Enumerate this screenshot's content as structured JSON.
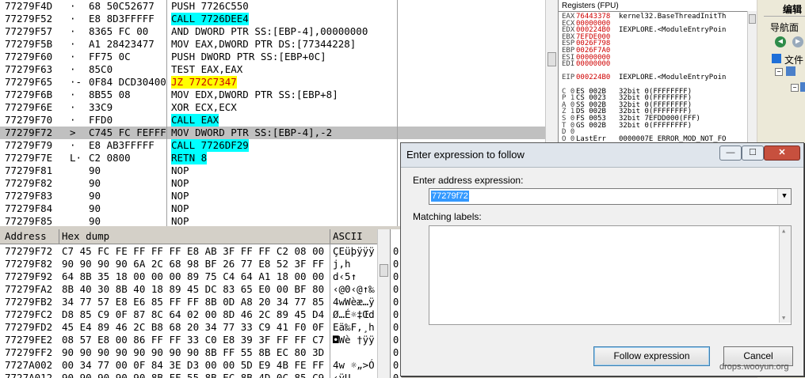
{
  "disasm": {
    "rows": [
      {
        "addr": "77279F4D",
        "mark": "·",
        "hex": "68 50C52677",
        "ins": "PUSH 7726C550",
        "hl": ""
      },
      {
        "addr": "77279F52",
        "mark": "·",
        "hex": "E8 8D3FFFFF",
        "ins": "CALL 7726DEE4",
        "hl": "cyan"
      },
      {
        "addr": "77279F57",
        "mark": "·",
        "hex": "8365 FC 00",
        "ins": "AND DWORD PTR SS:[EBP-4],00000000",
        "hl": ""
      },
      {
        "addr": "77279F5B",
        "mark": "·",
        "hex": "A1 28423477",
        "ins": "MOV EAX,DWORD PTR DS:[77344228]",
        "hl": ""
      },
      {
        "addr": "77279F60",
        "mark": "·",
        "hex": "FF75 0C",
        "ins": "PUSH DWORD PTR SS:[EBP+0C]",
        "hl": ""
      },
      {
        "addr": "77279F63",
        "mark": "·",
        "hex": "85C0",
        "ins": "TEST EAX,EAX",
        "hl": ""
      },
      {
        "addr": "77279F65",
        "mark": "·-",
        "hex": "0F84 DCD30400",
        "ins": "JZ 772C7347",
        "hl": "yellow"
      },
      {
        "addr": "77279F6B",
        "mark": "·",
        "hex": "8B55 08",
        "ins": "MOV EDX,DWORD PTR SS:[EBP+8]",
        "hl": ""
      },
      {
        "addr": "77279F6E",
        "mark": "·",
        "hex": "33C9",
        "ins": "XOR ECX,ECX",
        "hl": ""
      },
      {
        "addr": "77279F70",
        "mark": "·",
        "hex": "FFD0",
        "ins": "CALL EAX",
        "hl": "cyan"
      },
      {
        "addr": "77279F72",
        "mark": ">",
        "hex": "C745 FC FEFFFFFF",
        "ins": "MOV DWORD PTR SS:[EBP-4],-2",
        "hl": "",
        "sel": true
      },
      {
        "addr": "77279F79",
        "mark": "·",
        "hex": "E8 AB3FFFFF",
        "ins": "CALL 7726DF29",
        "hl": "cyan"
      },
      {
        "addr": "77279F7E",
        "mark": "L·",
        "hex": "C2 0800",
        "ins": "RETN 8",
        "hl": "cyan"
      },
      {
        "addr": "77279F81",
        "mark": "",
        "hex": "90",
        "ins": "NOP",
        "hl": ""
      },
      {
        "addr": "77279F82",
        "mark": "",
        "hex": "90",
        "ins": "NOP",
        "hl": ""
      },
      {
        "addr": "77279F83",
        "mark": "",
        "hex": "90",
        "ins": "NOP",
        "hl": ""
      },
      {
        "addr": "77279F84",
        "mark": "",
        "hex": "90",
        "ins": "NOP",
        "hl": ""
      },
      {
        "addr": "77279F85",
        "mark": "",
        "hex": "90",
        "ins": "NOP",
        "hl": ""
      }
    ]
  },
  "registers": {
    "title": "Registers (FPU)",
    "rows": [
      {
        "n": "EAX",
        "v": "76443378",
        "c": "kernel32.BaseThreadInitTh"
      },
      {
        "n": "ECX",
        "v": "00000000",
        "c": ""
      },
      {
        "n": "EDX",
        "v": "000224B0",
        "c": "IEXPLORE.<ModuleEntryPoin"
      },
      {
        "n": "EBX",
        "v": "7EFDE000",
        "c": ""
      },
      {
        "n": "ESP",
        "v": "0026F798",
        "c": ""
      },
      {
        "n": "EBP",
        "v": "0026F7A0",
        "c": ""
      },
      {
        "n": "ESI",
        "v": "00000000",
        "c": ""
      },
      {
        "n": "EDI",
        "v": "00000000",
        "c": ""
      },
      {
        "n": "",
        "v": "",
        "c": ""
      },
      {
        "n": "EIP",
        "v": "000224B0",
        "c": "IEXPLORE.<ModuleEntryPoin"
      },
      {
        "n": "",
        "v": "",
        "c": ""
      },
      {
        "n": "C 0",
        "v": "ES 002B",
        "c": "32bit 0(FFFFFFFF)",
        "blk": true
      },
      {
        "n": "P 1",
        "v": "CS 0023",
        "c": "32bit 0(FFFFFFFF)",
        "blk": true
      },
      {
        "n": "A 0",
        "v": "SS 002B",
        "c": "32bit 0(FFFFFFFF)",
        "blk": true
      },
      {
        "n": "Z 1",
        "v": "DS 002B",
        "c": "32bit 0(FFFFFFFF)",
        "blk": true
      },
      {
        "n": "S 0",
        "v": "FS 0053",
        "c": "32bit 7EFDD000(FFF)",
        "blk": true
      },
      {
        "n": "T 0",
        "v": "GS 002B",
        "c": "32bit 0(FFFFFFFF)",
        "blk": true
      },
      {
        "n": "D 0",
        "v": "",
        "c": "",
        "blk": true
      },
      {
        "n": "O 0",
        "v": "LastErr",
        "c": "0000007E ERROR_MOD_NOT_FO",
        "blk": true
      }
    ]
  },
  "rightstrip": {
    "menu_label": "编辑",
    "nav_label": "导航面",
    "file_label": "文件"
  },
  "hexdump": {
    "headers": {
      "address": "Address",
      "hex": "Hex dump",
      "ascii": "ASCII"
    },
    "rows": [
      {
        "addr": "77279F72",
        "bytes": "C7 45 FC FE FF FF FF E8 AB 3F FF FF C2 08 00",
        "ascii": "ÇEüþÿÿÿ"
      },
      {
        "addr": "77279F82",
        "bytes": "90 90 90 90 6A 2C 68 98 BF 26 77 E8 52 3F FF",
        "ascii": "    j,h"
      },
      {
        "addr": "77279F92",
        "bytes": "64 8B 35 18 00 00 00 89 75 C4 64 A1 18 00 00",
        "ascii": "d‹5↑"
      },
      {
        "addr": "77279FA2",
        "bytes": "8B 40 30 8B 40 18 89 45 DC 83 65 E0 00 BF 80",
        "ascii": "‹@0‹@↑‰"
      },
      {
        "addr": "77279FB2",
        "bytes": "34 77 57 E8 E6 85 FF FF 8B 0D A8 20 34 77 85",
        "ascii": "4wWèæ…ÿ"
      },
      {
        "addr": "77279FC2",
        "bytes": "D8 85 C9 0F 87 8C 64 02 00 8D 46 2C 89 45 D4",
        "ascii": "Ø…É☼‡Œd"
      },
      {
        "addr": "77279FD2",
        "bytes": "45 E4 89 46 2C B8 68 20 34 77 33 C9 41 F0 0F",
        "ascii": "Eä‰F,¸h"
      },
      {
        "addr": "77279FE2",
        "bytes": "08 57 E8 00 86 FF FF 33 C0 E8 39 3F FF FF C7",
        "ascii": "◘Wè †ÿÿ"
      },
      {
        "addr": "77279FF2",
        "bytes": "90 90 90 90 90 90 90 90 8B FF 55 8B EC 80 3D",
        "ascii": "        "
      },
      {
        "addr": "7727A002",
        "bytes": "00 34 77 00 0F 84 3E D3 00 00 5D E9 4B FE FF",
        "ascii": " 4w ☼„>Ó"
      },
      {
        "addr": "7727A012",
        "bytes": "90 90 90 90 90 8B FF 55 8B EC 8B 4D 0C 85 C9",
        "ascii": "     ‹ÿU"
      }
    ],
    "stack_digits": [
      "0",
      "0",
      "0",
      "0",
      "0",
      "0",
      "0",
      "0",
      "0",
      "0",
      "0"
    ]
  },
  "dialog": {
    "title": "Enter expression to follow",
    "address_label": "Enter address expression:",
    "address_value": "77279f72",
    "matching_label": "Matching labels:",
    "follow_button": "Follow expression",
    "cancel_button": "Cancel",
    "minimize_glyph": "—",
    "maximize_glyph": "☐",
    "close_glyph": "✕"
  },
  "watermark": "drops.wooyun.org"
}
